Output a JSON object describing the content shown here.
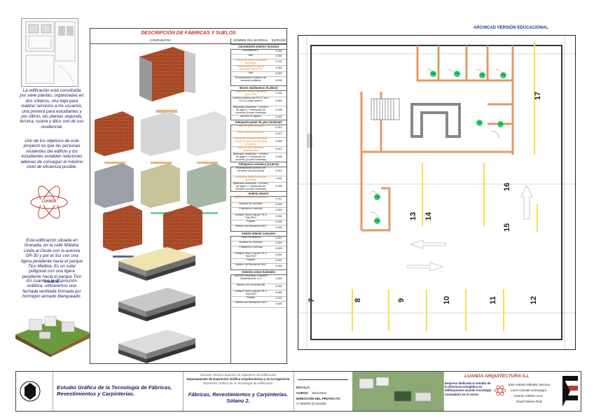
{
  "watermark": "ARCHICAD VERSIÓN EDUCACIONAL",
  "sidebar": {
    "p1": "La edificación está constituida por siete plantas, organizadas en dos sótanos, una baja para realizar servicios a los usuarios, una primera para estudiantes y por último, las plantas segunda, tercera, cuarta y ático son de uso residencial.",
    "p2": "Uno de los objetivos de este proyecto es que las personas residentes del edificio y los estudiantes entablen relaciones ademas de conseguir el máximo nivel de eficiencia posible.",
    "logo_text": "LUANDA",
    "p3": "Esta edificación situada en Granada, en la calle Malahá. Linda al Oeste con la autovía GR-30 y por el Sur con una ligera pendiente hacia el parque Tico Medina. Es un solar poligonal con una ligera pendiente hacia el parque Tico Medina.",
    "p4": "En cuanto a la disposición estética, utilizaremos una fachada ventilada formada por hormigón armado blanqueado."
  },
  "table": {
    "title": "DESCRIPCIÓN DE FÁBRICAS Y SUELOS",
    "col_composite": "COMPUESTOS",
    "col_material": "NOMBRE DEL MATERIAL",
    "col_thickness": "ESPESOR",
    "sections": [
      {
        "title": "Cerramiento exterior (0,33cm)",
        "rows": [
          {
            "m": "Acrodilarme E",
            "v": "0,040",
            "o": false
          },
          {
            "m": "Aire",
            "v": "0,050",
            "o": false
          },
          {
            "m": "Fábrica de ladrillo cerámico perforado",
            "v": "0,115",
            "o": true
          },
          {
            "m": "Lana mineral 57 kAw30 CROMAS INERTES",
            "v": "0,060",
            "o": true
          },
          {
            "m": "Aire",
            "v": "0,015",
            "o": false
          },
          {
            "m": "Revestimiento cerámico de fachada ventilada",
            "v": "0,020",
            "o": false
          }
        ]
      },
      {
        "title": "Muros medianeros (0,18cm)",
        "rows": [
          {
            "m": "Fábrica de ladrillo cerámico perforado",
            "v": "0,115",
            "o": true
          },
          {
            "m": "Lámina continua de PU 17 cm / 0,5 cm polipropileno",
            "v": "0,050",
            "o": false
          },
          {
            "m": "Baldosas cerámicas + mortero de agarre + enfoscado de cemento (Zonas húmedas)",
            "v": "0,035",
            "o": false
          },
          {
            "m": "Mortero de agarre",
            "v": "0,015",
            "o": false
          }
        ]
      },
      {
        "title": "Tabiquería panel de yeso laminado",
        "rows": [
          {
            "m": "Placa de yeso laminado",
            "v": "0,013",
            "o": true
          },
          {
            "m": "Lana mineral 40 kAw30",
            "v": "0,012",
            "o": true
          },
          {
            "m": "Estructura metálica Montante Canal de acero galvanizado (Interior)",
            "v": "0,050",
            "o": true
          },
          {
            "m": "Placa de yeso laminado antihumedad",
            "v": "0,012",
            "o": true
          },
          {
            "m": "Baldosas cerámicas + mortero de agarre + enfoscado de cemento (Zonas húmedas)",
            "v": "0,035",
            "o": false
          }
        ]
      },
      {
        "title": "Tabiquería cerámica (14.5cm)",
        "rows": [
          {
            "m": "Revestimiento Mortero de cemento (Zonas secas)",
            "v": "0,015",
            "o": false
          },
          {
            "m": "Fábrica de ladrillo cerámico perforado",
            "v": "0,115",
            "o": true
          },
          {
            "m": "Baldosas cerámicas + mortero de agarre + enfoscado de cemento (Zonas húmedas)",
            "v": "0,035",
            "o": false
          }
        ]
      },
      {
        "title": "Solería interior",
        "rows": [
          {
            "m": "Madera Porcelánico (Interior)",
            "v": "0,012",
            "o": true
          },
          {
            "m": "Mortero de cemento",
            "v": "0,020",
            "o": false
          },
          {
            "m": "Poliestireno extruido",
            "v": "0,003",
            "o": false
          },
          {
            "m": "Grafipol Termo Impact TR-4 \"VALERO\"",
            "v": "0,050",
            "o": false
          },
          {
            "m": "Forjado",
            "v": "0,001",
            "o": false
          },
          {
            "m": "Mortero de Nivelación M10",
            "v": "0,040",
            "o": false
          }
        ]
      },
      {
        "title": "Solería interior comunes",
        "rows": [
          {
            "m": "Gres Porcelánico",
            "v": "0,012",
            "o": false
          },
          {
            "m": "Mortero de cemento",
            "v": "0,025",
            "o": false
          },
          {
            "m": "Poliestireno extruido",
            "v": "0,003",
            "o": false
          },
          {
            "m": "Grafipol Termo Impact TR-4 \"VALERO\"",
            "v": "0,050",
            "o": false
          },
          {
            "m": "Forjado",
            "v": "0,001",
            "o": false
          },
          {
            "m": "Mortero de Nivelación M10",
            "v": "0,040",
            "o": false
          }
        ]
      },
      {
        "title": "Solerías zonas húmedas",
        "rows": [
          {
            "m": "Gres de Porcelana Cerámico Antideslizante cl.3",
            "v": "0,020",
            "o": false
          },
          {
            "m": "Mortero de Cemento M5",
            "v": "0,020",
            "o": false
          },
          {
            "m": "Grafipol Termo Impact TR-4 \"VALERO\"",
            "v": "0,050",
            "o": false
          },
          {
            "m": "Forjado",
            "v": "0,001",
            "o": false
          },
          {
            "m": "Mortero de Nivelación M10",
            "v": "0,040",
            "o": false
          }
        ]
      }
    ]
  },
  "plan": {
    "parking_numbers": [
      "7",
      "8",
      "9",
      "10",
      "11",
      "12",
      "13",
      "14",
      "15",
      "16",
      "17"
    ],
    "tags": [
      "P05",
      "P05",
      "P05",
      "P05",
      "P05",
      "P05",
      "P05",
      "P05"
    ]
  },
  "footer": {
    "title": "Estudio Gráfico de la Tecnología de Fábricas, Revestimientos y Carpinterías.",
    "school_line1": "Escuela Técnica Superior de Ingeniería de Edificación",
    "school_line2": "Departamento de Expresión Gráfica Arquitectónica y en la Ingeniería",
    "school_line3": "Expresión Gráfica de la Tecnología de Edificación",
    "sheet_title": "Fábricas, Revestimientos y Carpinterías. Sótano 2.",
    "escala_label": "ESCALA:",
    "curso_label": "CURSO:",
    "curso_value": "2021/2022",
    "direccion_label": "DIRECCIÓN DEL PROYECTO:",
    "direccion_value": "C/ Malahá (Granada)",
    "company": "LUANDA ARQUITECTURA S.L",
    "tagline": "Empresa dedicada al estudio de la eficiencia energética en edificaciones usando tecnología innovadora en el sector",
    "team": [
      "Jose Antonio Méndez Serrano",
      "Lucía Casado Consuegra",
      "Antonio Vílchez Arco",
      "David Solano Ruiz"
    ]
  },
  "colors": {
    "accent": "#c0392b",
    "wall": "#f0b27a",
    "yellow": "#f4e04d",
    "green": "#2ecc71",
    "navy": "#1a1a66"
  }
}
